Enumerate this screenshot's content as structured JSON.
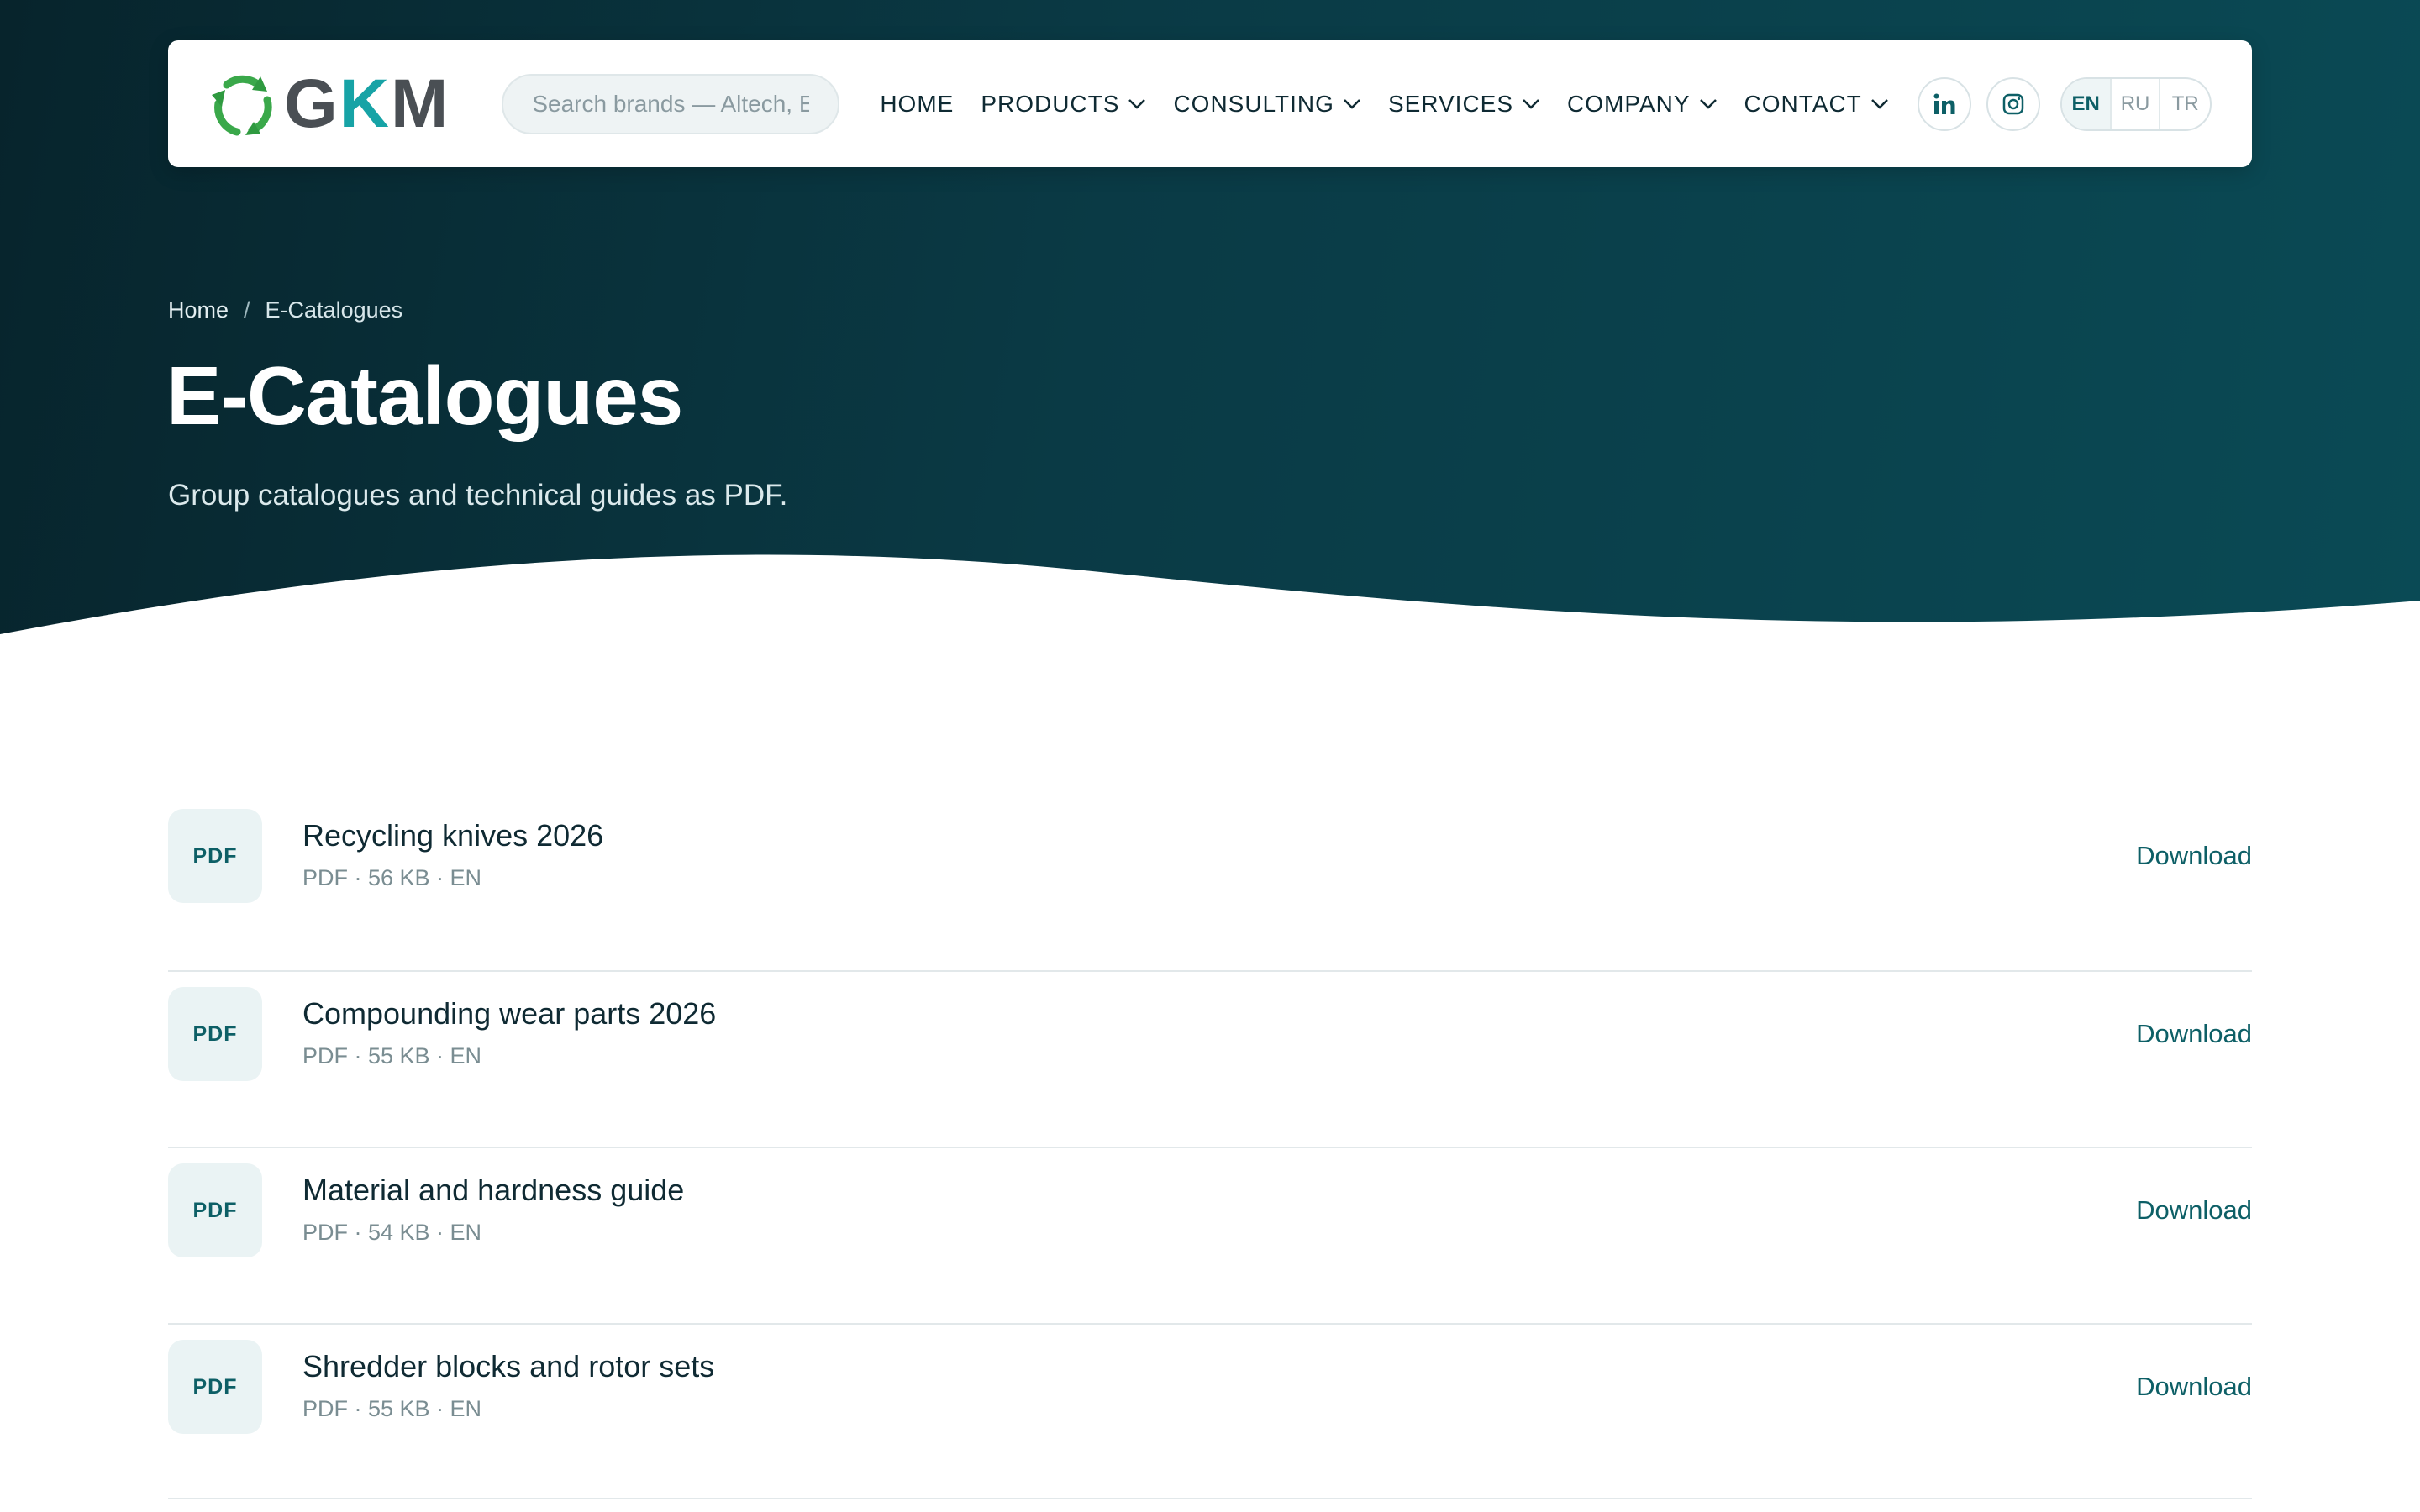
{
  "brand": {
    "logo_text_g": "G",
    "logo_text_k": "K",
    "logo_text_m": "M",
    "accent_color": "#17a3a6",
    "logo_leaf_color": "#3aa84a"
  },
  "search": {
    "placeholder": "Search brands — Altech, Ere"
  },
  "nav": {
    "items": [
      {
        "label": "HOME",
        "has_dropdown": false
      },
      {
        "label": "PRODUCTS",
        "has_dropdown": true
      },
      {
        "label": "CONSULTING",
        "has_dropdown": true
      },
      {
        "label": "SERVICES",
        "has_dropdown": true
      },
      {
        "label": "COMPANY",
        "has_dropdown": true
      },
      {
        "label": "CONTACT",
        "has_dropdown": true
      }
    ]
  },
  "social": {
    "icons": [
      "linkedin-icon",
      "instagram-icon"
    ]
  },
  "languages": {
    "options": [
      "EN",
      "RU",
      "TR"
    ],
    "active": "EN"
  },
  "breadcrumb": {
    "home": "Home",
    "separator": "/",
    "current": "E-Catalogues"
  },
  "page": {
    "title": "E-Catalogues",
    "subtitle": "Group catalogues and technical guides as PDF."
  },
  "catalogues": {
    "badge": "PDF",
    "download_label": "Download",
    "items": [
      {
        "title": "Recycling knives 2026",
        "meta": "PDF · 56 KB · EN"
      },
      {
        "title": "Compounding wear parts 2026",
        "meta": "PDF · 55 KB · EN"
      },
      {
        "title": "Material and hardness guide",
        "meta": "PDF · 54 KB · EN"
      },
      {
        "title": "Shredder blocks and rotor sets",
        "meta": "PDF · 55 KB · EN"
      }
    ]
  },
  "colors": {
    "hero_dark": "#07242c",
    "hero_teal": "#0a4a55",
    "link": "#0d5f66"
  }
}
